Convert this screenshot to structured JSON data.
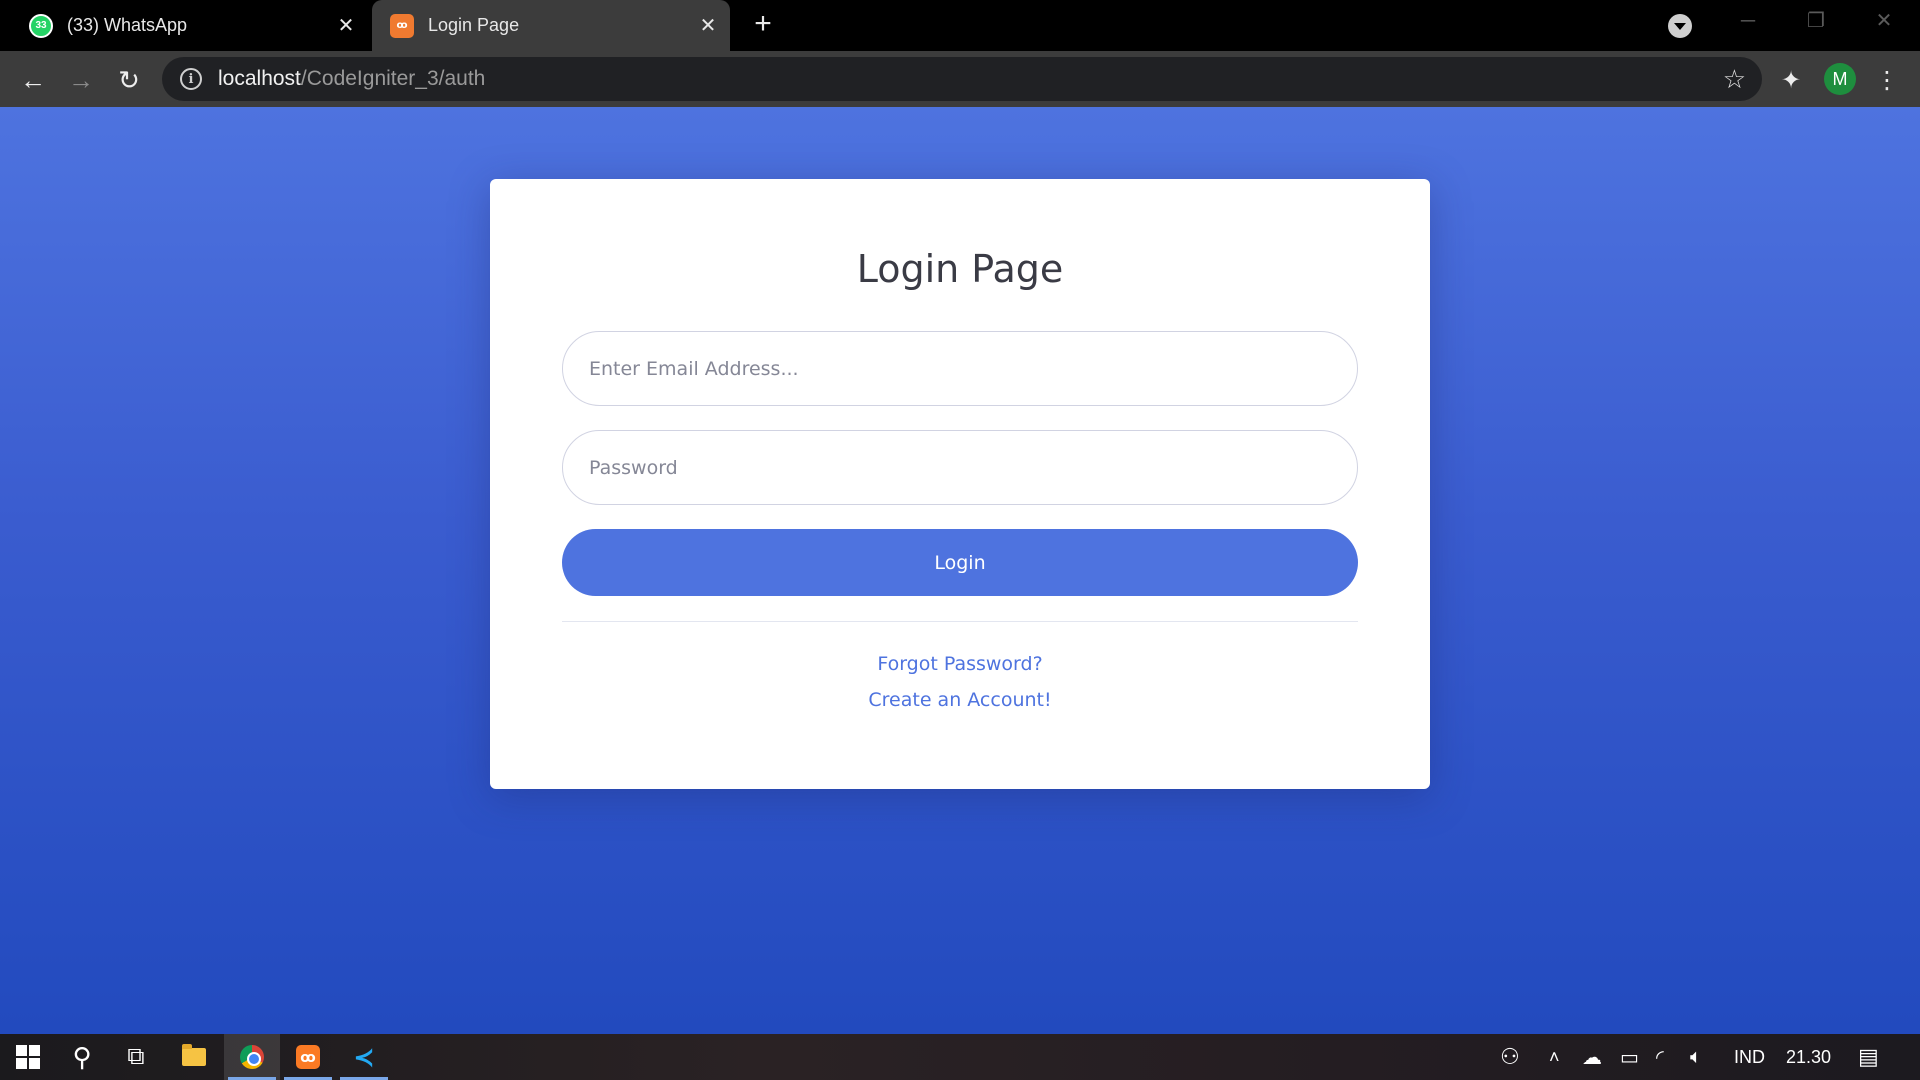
{
  "browser": {
    "tabs": [
      {
        "title": "(33) WhatsApp",
        "badge": "33",
        "icon": "whatsapp-icon",
        "color": "#25d366"
      },
      {
        "title": "Login Page",
        "badge": "ꝏ",
        "icon": "xampp-icon",
        "color": "#f07a30"
      }
    ],
    "close_glyph": "✕",
    "new_tab_glyph": "+",
    "url_host": "localhost",
    "url_path": "/CodeIgniter_3/auth",
    "profile_initial": "M"
  },
  "page": {
    "title": "Login Page",
    "email_placeholder": "Enter Email Address...",
    "password_placeholder": "Password",
    "login_label": "Login",
    "forgot_label": "Forgot Password?",
    "create_label": "Create an Account!",
    "accent_color": "#4e73df"
  },
  "taskbar": {
    "language": "IND",
    "time": "21.30"
  }
}
